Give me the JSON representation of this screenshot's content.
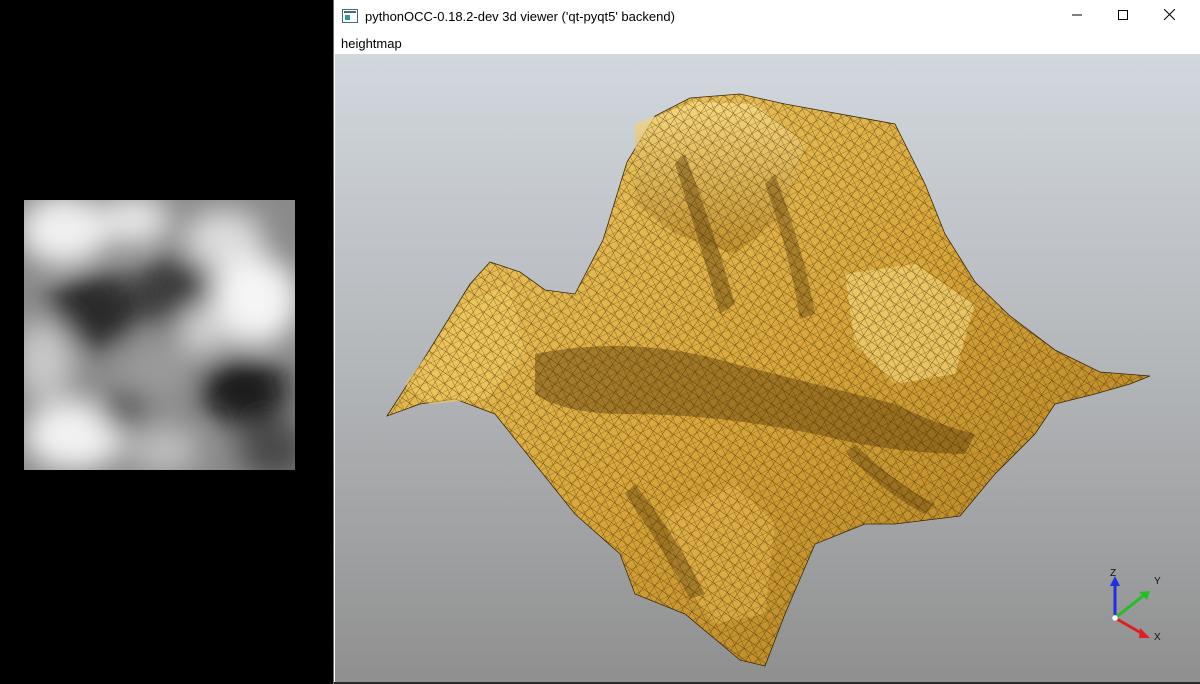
{
  "window": {
    "title": "pythonOCC-0.18.2-dev 3d viewer ('qt-pyqt5' backend)",
    "icon": "app-window-icon",
    "controls": {
      "minimize_icon": "minimize-icon",
      "maximize_icon": "maximize-icon",
      "close_icon": "close-icon"
    }
  },
  "menu": {
    "items": [
      {
        "label": "heightmap"
      }
    ]
  },
  "viewport": {
    "background_top": "#d2d8de",
    "background_bottom": "#8f8f8f",
    "surface_color": "#e8b84a",
    "mesh_color": "#3a2a05"
  },
  "axis_triad": {
    "x_label": "X",
    "y_label": "Y",
    "z_label": "Z",
    "x_color": "#e02020",
    "y_color": "#20c020",
    "z_color": "#2030e0"
  },
  "heightmap_preview": {
    "icon": "grayscale-heightmap-image"
  }
}
